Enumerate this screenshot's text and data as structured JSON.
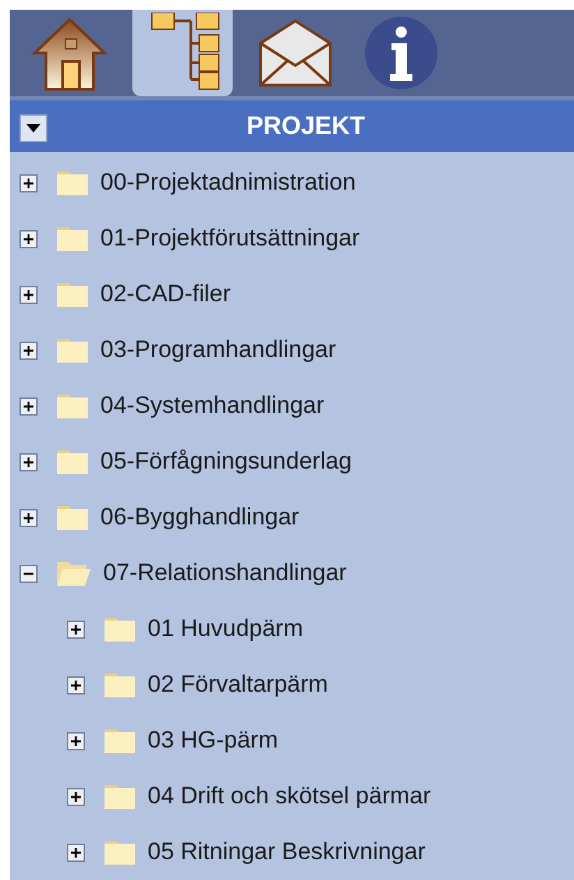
{
  "toolbar": {
    "buttons": [
      {
        "kind": "home",
        "selected": false
      },
      {
        "kind": "tree",
        "selected": true
      },
      {
        "kind": "mail",
        "selected": false
      },
      {
        "kind": "info",
        "selected": false
      }
    ]
  },
  "panel": {
    "title": "PROJEKT"
  },
  "tree": [
    {
      "label": "00-Projektadnimistration",
      "expanded": false
    },
    {
      "label": "01-Projektförutsättningar",
      "expanded": false
    },
    {
      "label": "02-CAD-filer",
      "expanded": false
    },
    {
      "label": "03-Programhandlingar",
      "expanded": false
    },
    {
      "label": "04-Systemhandlingar",
      "expanded": false
    },
    {
      "label": "05-Förfågningsunderlag",
      "expanded": false
    },
    {
      "label": "06-Bygghandlingar",
      "expanded": false
    },
    {
      "label": "07-Relationshandlingar",
      "expanded": true,
      "children": [
        {
          "label": "01 Huvudpärm",
          "expanded": false
        },
        {
          "label": "02 Förvaltarpärm",
          "expanded": false
        },
        {
          "label": "03 HG-pärm",
          "expanded": false
        },
        {
          "label": "04 Drift och skötsel pärmar",
          "expanded": false
        },
        {
          "label": "05 Ritningar Beskrivningar",
          "expanded": false
        }
      ]
    }
  ]
}
